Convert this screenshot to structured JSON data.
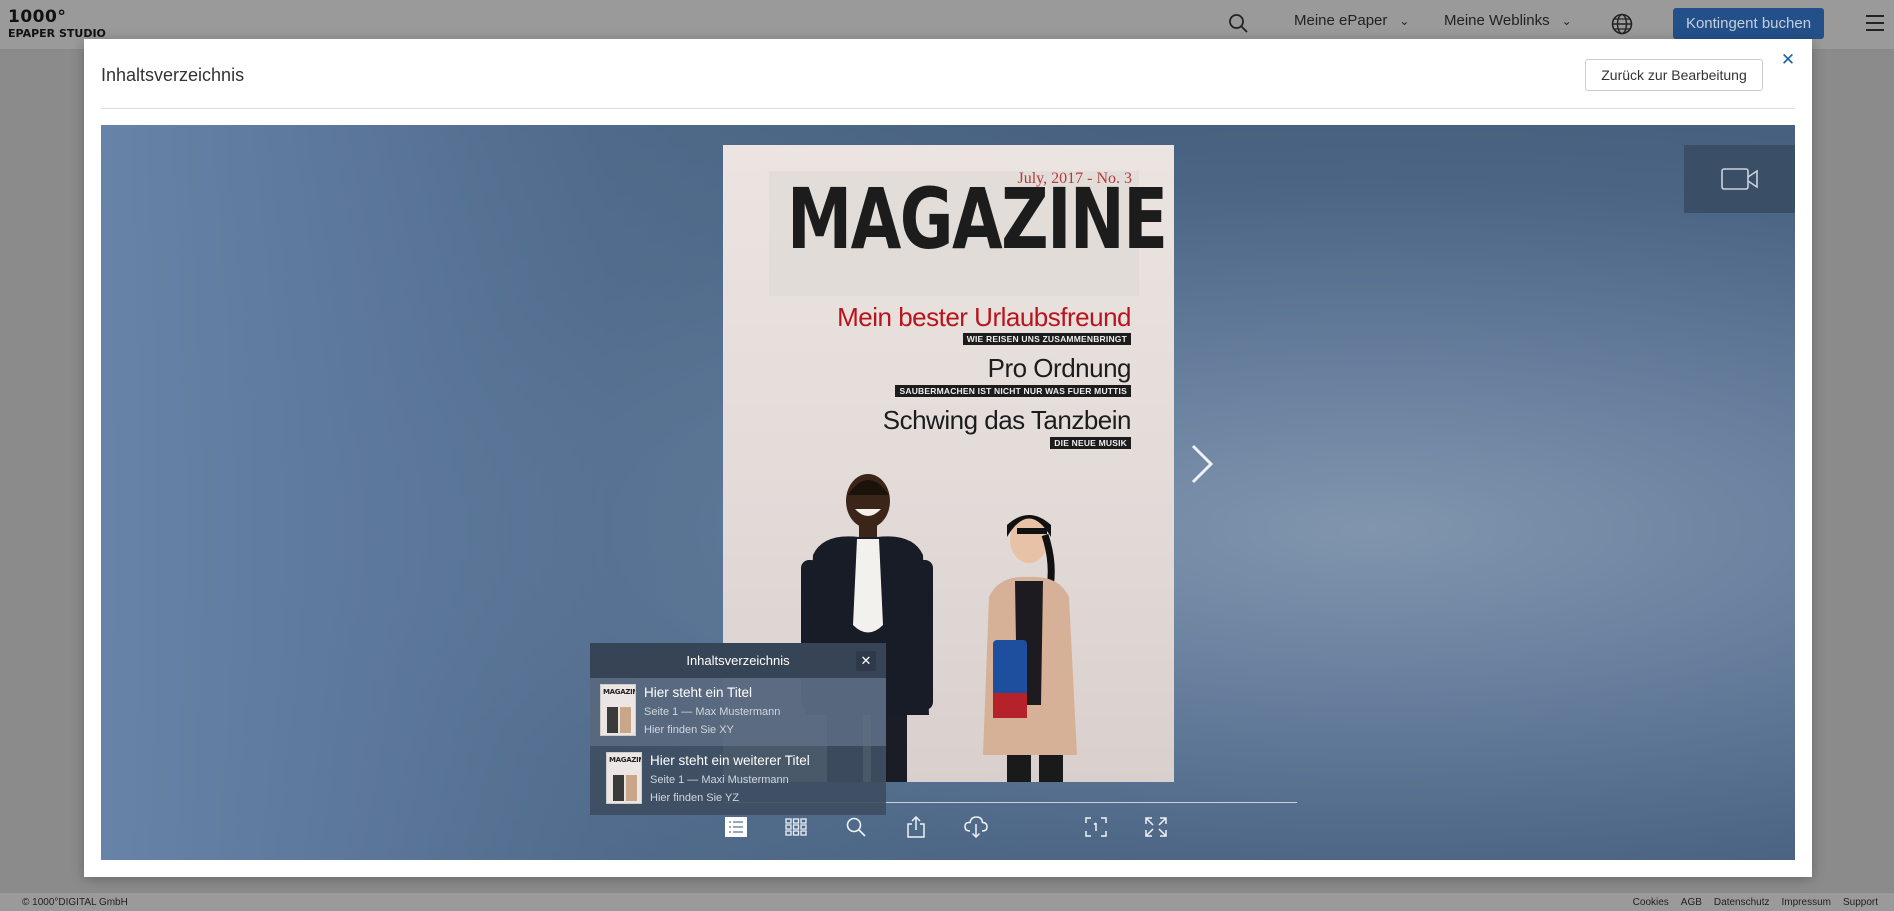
{
  "app": {
    "logo_line1": "1000°",
    "logo_line2": "EPAPER STUDIO",
    "nav": {
      "my_epaper": "Meine ePaper",
      "my_weblinks": "Meine Weblinks",
      "book_quota": "Kontingent buchen"
    },
    "icons": {
      "search": "search-icon",
      "language": "globe-icon",
      "menu": "hamburger-menu-icon"
    },
    "footer": {
      "copyright": "© 1000°DIGITAL GmbH",
      "links": [
        "Cookies",
        "AGB",
        "Datenschutz",
        "Impressum",
        "Support"
      ]
    }
  },
  "modal": {
    "title": "Inhaltsverzeichnis",
    "back_button": "Zurück zur Bearbeitung"
  },
  "magazine": {
    "date_line": "July, 2017 - No. 3",
    "masthead": "MAGAZINE",
    "headlines": [
      {
        "title": "Mein bester Urlaubsfreund",
        "tag": "WIE REISEN UNS ZUSAMMENBRINGT",
        "color": "#b8141e"
      },
      {
        "title": "Pro Ordnung",
        "tag": "SAUBERMACHEN IST NICHT NUR WAS FUER MUTTIS"
      },
      {
        "title": "Schwing das Tanzbein",
        "tag": "DIE NEUE MUSIK"
      }
    ]
  },
  "toc": {
    "title": "Inhaltsverzeichnis",
    "thumb_label": "MAGAZINE",
    "items": [
      {
        "title": "Hier steht ein Titel",
        "meta": "Seite 1 — Max Mustermann",
        "desc": "Hier finden Sie XY"
      },
      {
        "title": "Hier steht ein weiterer Titel",
        "meta": "Seite 1 — Maxi Mustermann",
        "desc": "Hier finden Sie YZ"
      }
    ]
  },
  "toolbar": {
    "icons": [
      "toc-list-icon",
      "grid-overview-icon",
      "search-icon",
      "share-icon",
      "download-icon",
      "page-number-icon",
      "fullscreen-icon"
    ]
  },
  "colors": {
    "accent": "#1f5fa8",
    "headline_red": "#b8141e",
    "button_blue": "#24508a"
  }
}
